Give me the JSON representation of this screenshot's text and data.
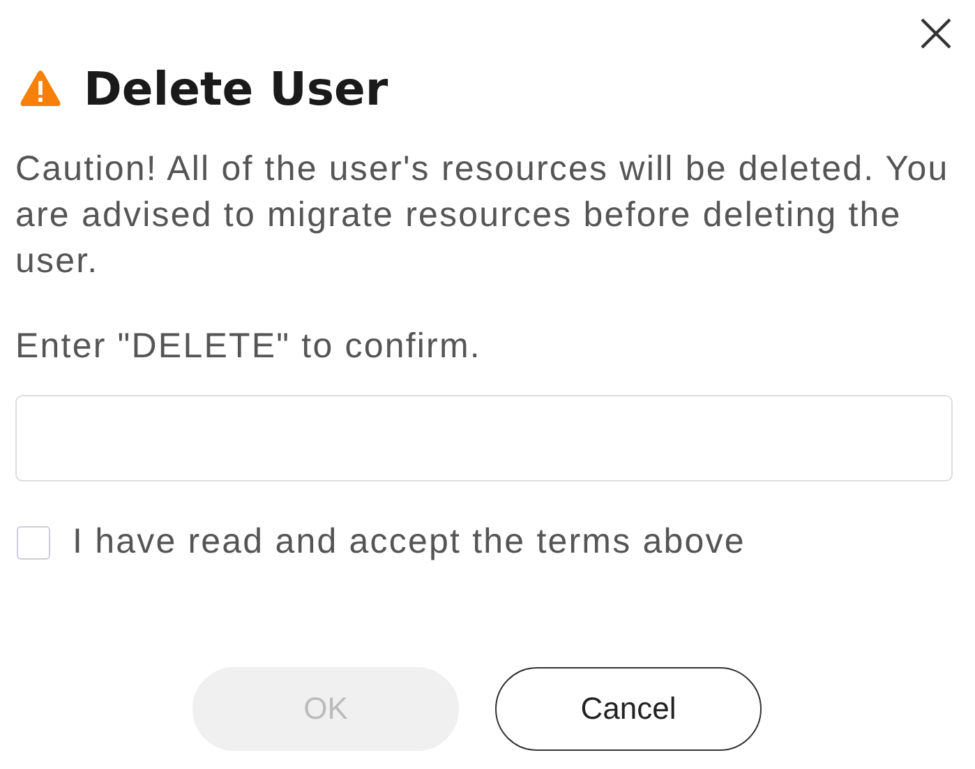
{
  "dialog": {
    "title": "Delete User",
    "message": "Caution! All of the user's resources will be deleted. You are advised to migrate resources before deleting the user.",
    "prompt": "Enter \"DELETE\" to confirm.",
    "agreement": {
      "label": "I have read and accept the terms above",
      "checked": false
    },
    "buttons": [
      {
        "label": "OK",
        "disabled": true
      },
      {
        "label": "Cancel",
        "disabled": false
      }
    ]
  }
}
